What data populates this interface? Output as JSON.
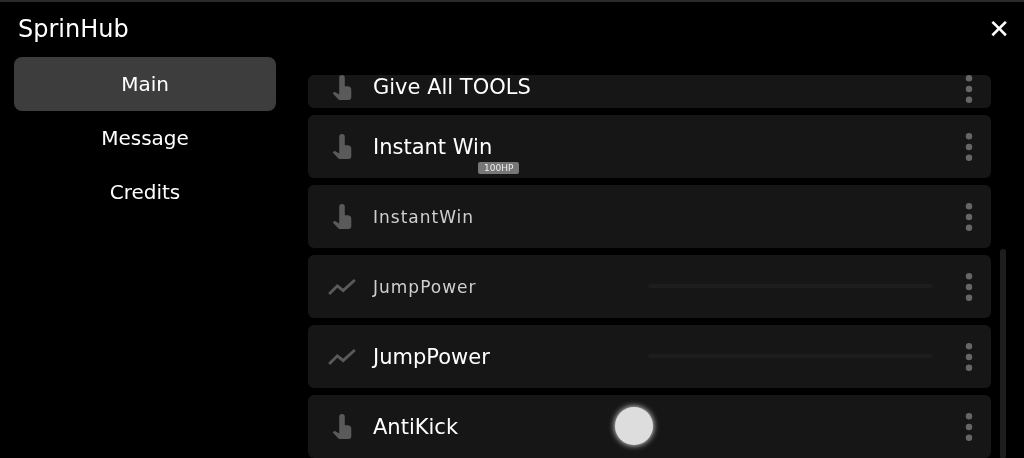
{
  "window": {
    "title": "SprinHub",
    "close": "✕"
  },
  "sidebar": {
    "items": [
      {
        "label": "Main",
        "selected": true
      },
      {
        "label": "Message",
        "selected": false
      },
      {
        "label": "Credits",
        "selected": false
      }
    ]
  },
  "features": [
    {
      "kind": "button",
      "label": "Give All TOOLS",
      "clipped": true
    },
    {
      "kind": "button",
      "label": "Instant Win",
      "badge": "100HP"
    },
    {
      "kind": "button",
      "label": "InstantWin",
      "garbled": true
    },
    {
      "kind": "slider",
      "label": "JumpPower",
      "garbled": true
    },
    {
      "kind": "slider",
      "label": "JumpPower"
    },
    {
      "kind": "button",
      "label": "AntiKick",
      "touch": true
    }
  ]
}
